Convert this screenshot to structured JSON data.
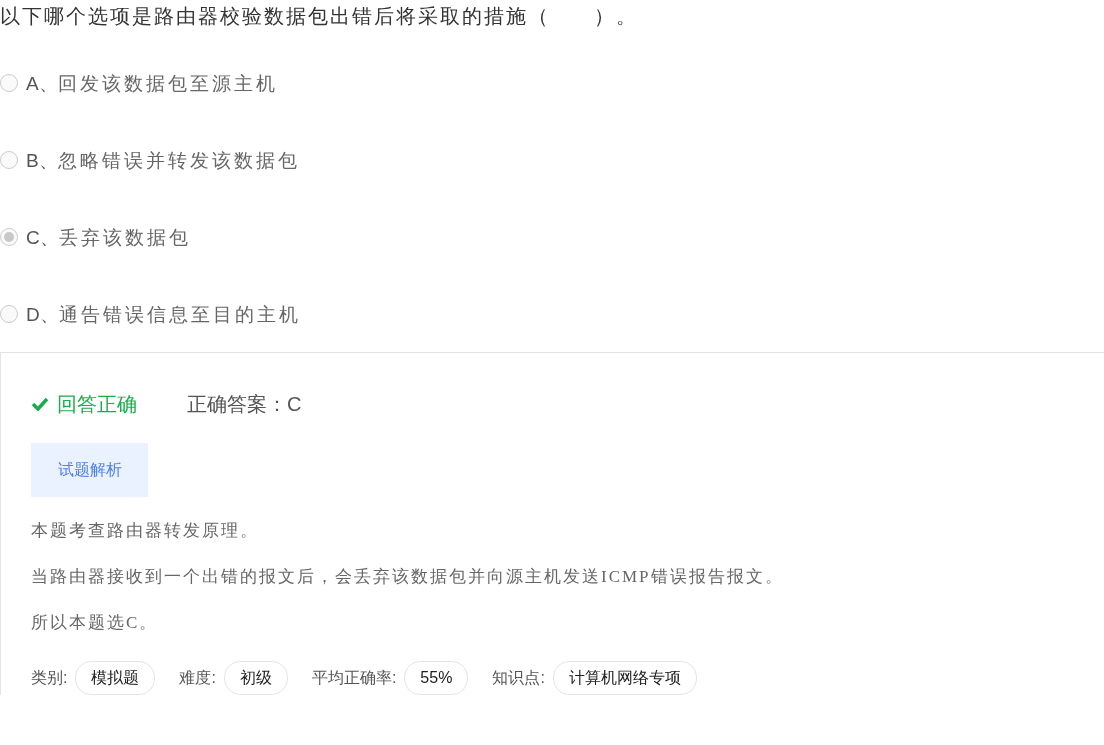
{
  "question": "以下哪个选项是路由器校验数据包出错后将采取的措施（　　）。",
  "options": [
    {
      "letter": "A、",
      "text": "回发该数据包至源主机",
      "selected": false
    },
    {
      "letter": "B、",
      "text": "忽略错误并转发该数据包",
      "selected": false
    },
    {
      "letter": "C、",
      "text": "丢弃该数据包",
      "selected": true
    },
    {
      "letter": "D、",
      "text": "通告错误信息至目的主机",
      "selected": false
    }
  ],
  "result": {
    "correct": true,
    "status": "回答正确",
    "answer": "正确答案：C"
  },
  "analysis_tab": "试题解析",
  "explanation": [
    "本题考查路由器转发原理。",
    "当路由器接收到一个出错的报文后，会丢弃该数据包并向源主机发送ICMP错误报告报文。",
    "所以本题选C。"
  ],
  "meta": [
    {
      "label": "类别:",
      "value": "模拟题"
    },
    {
      "label": "难度:",
      "value": "初级"
    },
    {
      "label": "平均正确率:",
      "value": "55%"
    },
    {
      "label": "知识点:",
      "value": "计算机网络专项"
    }
  ]
}
